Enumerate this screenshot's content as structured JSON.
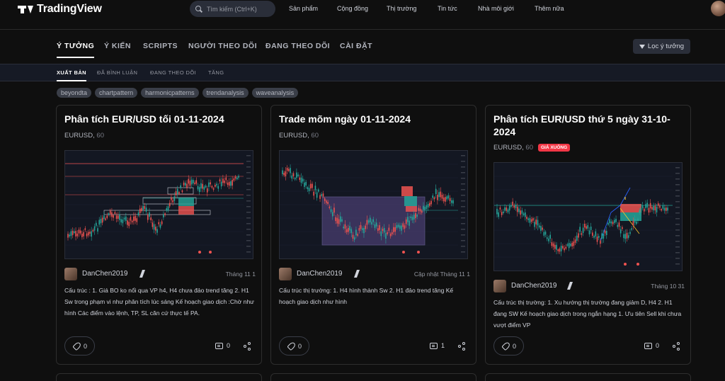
{
  "brand": {
    "name": "TradingView"
  },
  "search": {
    "placeholder": "Tìm kiếm (Ctrl+K)"
  },
  "topnav": [
    "Sản phẩm",
    "Cộng đồng",
    "Thị trường",
    "Tin tức",
    "Nhà môi giới",
    "Thêm nữa"
  ],
  "tabs": [
    "Ý TƯỞNG",
    "Ý KIẾN",
    "SCRIPTS",
    "NGƯỜI THEO DÕI",
    "ĐANG THEO DÕI",
    "CÀI ĐẶT"
  ],
  "filter_label": "Lọc ý tưởng",
  "subtabs": [
    "XUẤT BẢN",
    "ĐÃ BÌNH LUẬN",
    "ĐANG THEO DÕI",
    "TĂNG"
  ],
  "tags": [
    "beyondta",
    "chartpattern",
    "harmonicpatterns",
    "trendanalysis",
    "waveanalysis"
  ],
  "cards": [
    {
      "title": "Phân tích EUR/USD tối 01-11-2024",
      "symbol": "EURUSD,",
      "timeframe": "60",
      "author": "DanChen2019",
      "date": "Tháng 11 1",
      "description": "Cấu trúc : 1. Giá BO ko nổi qua VP h4, H4 chưa đảo trend tăng 2. H1 Sw trong phạm vi như phân tích lúc sáng Kế hoạch giao dịch :Chờ như hình Các điểm vào lệnh, TP, SL căn cứ thực tế PA.",
      "boosts": "0",
      "comments": "0"
    },
    {
      "title": "Trade mõm ngày 01-11-2024",
      "symbol": "EURUSD,",
      "timeframe": "60",
      "author": "DanChen2019",
      "date": "Cập nhật Tháng 11 1",
      "description": "Cấu trúc thị trường: 1. H4 hình thành Sw 2. H1 đảo trend tăng Kế hoạch giao dịch như hình",
      "boosts": "0",
      "comments": "1"
    },
    {
      "title": "Phân tích EUR/USD thứ 5 ngày 31-10-2024",
      "symbol": "EURUSD,",
      "timeframe": "60",
      "badge": "GIÁ XUỐNG",
      "author": "DanChen2019",
      "date": "Tháng 10 31",
      "description": "Cấu trúc thị trường: 1. Xu hướng thị trường đang giảm D, H4 2. H1 đang SW Kế hoạch giao dịch trong ngắn hạng 1. Ưu tiên Sell khi chưa vượt điểm VP",
      "boosts": "0",
      "comments": "0"
    }
  ],
  "colors": {
    "accent": "#2962ff",
    "up": "#26a69a",
    "down": "#ef5350",
    "badge": "#f23645"
  }
}
